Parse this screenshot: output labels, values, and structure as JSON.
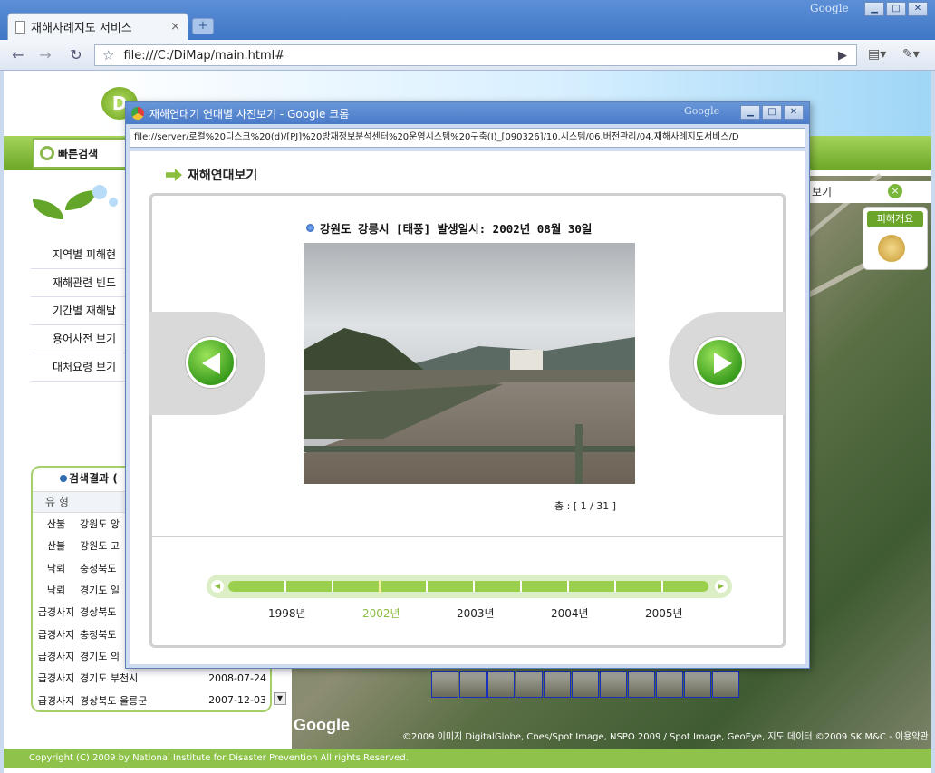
{
  "browser": {
    "tab_title": "재해사례지도 서비스",
    "brand": "Google",
    "url": "file:///C:/DiMap/main.html#"
  },
  "page": {
    "logo": "D",
    "quick_search": "빠른검색",
    "menu": [
      "지역별 피해현",
      "재해관련 빈도",
      "기간별 재해발",
      "용어사전 보기",
      "대처요령 보기"
    ],
    "results": {
      "title": "검색결과 (",
      "col_type": "유 형",
      "rows": [
        {
          "type": "산불",
          "place": "강원도 앙",
          "date": ""
        },
        {
          "type": "산불",
          "place": "강원도 고",
          "date": ""
        },
        {
          "type": "낙뢰",
          "place": "충청북도",
          "date": ""
        },
        {
          "type": "낙뢰",
          "place": "경기도 일",
          "date": ""
        },
        {
          "type": "급경사지",
          "place": "경상북도",
          "date": ""
        },
        {
          "type": "급경사지",
          "place": "충청북도",
          "date": ""
        },
        {
          "type": "급경사지",
          "place": "경기도 의",
          "date": ""
        },
        {
          "type": "급경사지",
          "place": "경기도 부천시",
          "date": "2008-07-24"
        },
        {
          "type": "급경사지",
          "place": "경상북도 울릉군",
          "date": "2007-12-03"
        }
      ]
    },
    "map_tab": "보기",
    "damage_label": "피해개요",
    "map_copyright": "©2009 이미지 DigitalGlobe, Cnes/Spot Image, NSPO 2009 / Spot Image, GeoEye, 지도 데이터 ©2009 SK M&C - 이용약관",
    "google_logo": "Google",
    "footer": "Copyright (C) 2009 by National Institute for Disaster Prevention All rights Reserved."
  },
  "popup": {
    "title": "재해연대기 연대별 사진보기 - Google 크롬",
    "brand": "Google",
    "url": "file://server/로컬%20디스크%20(d)/[PJ]%20방재정보분석센터%20운영시스템%20구축(I)_[090326]/10.시스템/06.버전관리/04.재해사례지도서비스/D",
    "section_title": "재해연대보기",
    "caption": "강원도 강릉시 [태풍]  발생일시: 2002년 08월 30일",
    "counter": "총 : [ 1 / 31 ]",
    "timeline": {
      "years": [
        "1998년",
        "2002년",
        "2003년",
        "2004년",
        "2005년"
      ],
      "selected": "2002년"
    }
  }
}
